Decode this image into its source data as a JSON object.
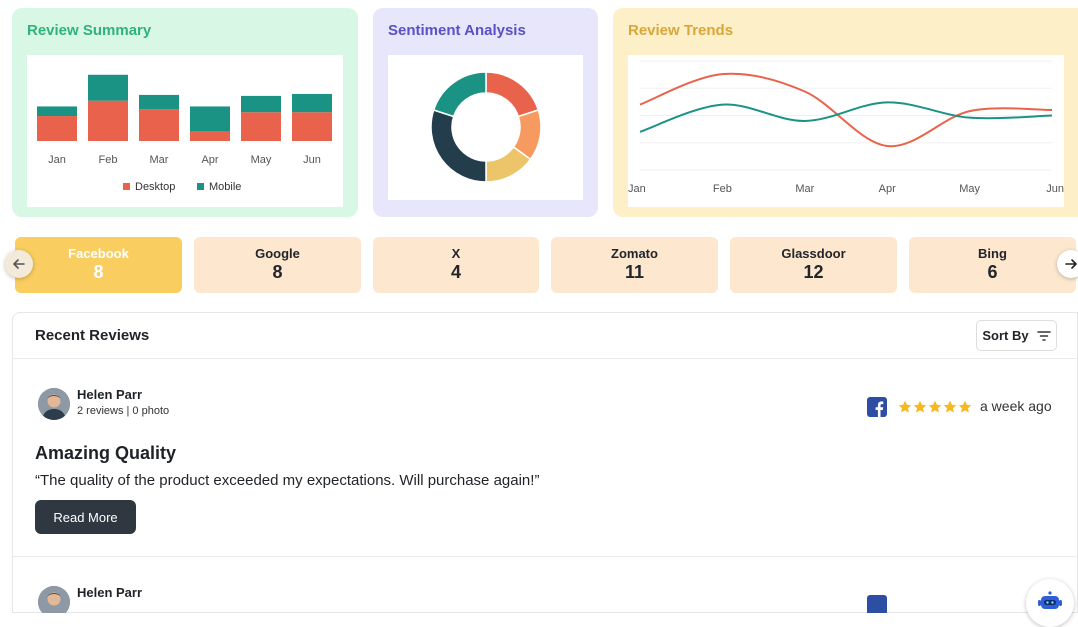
{
  "colors": {
    "desktop": "#e9634c",
    "mobile": "#1a9385",
    "summary_bg": "#d9f7e5",
    "sentiment_bg": "#e8e6fb",
    "trends_bg": "#fdf0c8",
    "chip_bg": "#fde7cf",
    "chip_active_bg": "#f9cd60",
    "button_dark": "#2f3841",
    "star": "#f5b921"
  },
  "review_summary": {
    "title": "Review Summary",
    "chart_data": {
      "type": "bar",
      "stacked": true,
      "categories": [
        "Jan",
        "Feb",
        "Mar",
        "Apr",
        "May",
        "Jun"
      ],
      "series": [
        {
          "name": "Desktop",
          "color": "#e9634c",
          "values": [
            26,
            42,
            33,
            10,
            30,
            30
          ]
        },
        {
          "name": "Mobile",
          "color": "#1a9385",
          "values": [
            10,
            27,
            15,
            26,
            17,
            19
          ]
        }
      ],
      "ylim": [
        0,
        75
      ],
      "legend": "bottom",
      "grid": false
    }
  },
  "sentiment": {
    "title": "Sentiment Analysis",
    "chart_data": {
      "type": "pie",
      "donut": true,
      "slices": [
        {
          "value": 20,
          "color": "#e9634c"
        },
        {
          "value": 15,
          "color": "#f79a5f"
        },
        {
          "value": 15,
          "color": "#ecc56a"
        },
        {
          "value": 30,
          "color": "#233d4d"
        },
        {
          "value": 20,
          "color": "#1a9385"
        }
      ]
    }
  },
  "trends": {
    "title": "Review Trends",
    "chart_data": {
      "type": "line",
      "categories": [
        "Jan",
        "Feb",
        "Mar",
        "Apr",
        "May",
        "Jun"
      ],
      "series": [
        {
          "color": "#e9634c",
          "values": [
            60,
            88,
            72,
            22,
            54,
            55
          ]
        },
        {
          "color": "#1a9385",
          "values": [
            35,
            60,
            45,
            62,
            48,
            50
          ]
        }
      ],
      "ylim": [
        0,
        100
      ],
      "grid": true
    }
  },
  "platforms": [
    {
      "name": "Facebook",
      "count": "8"
    },
    {
      "name": "Google",
      "count": "8"
    },
    {
      "name": "X",
      "count": "4"
    },
    {
      "name": "Zomato",
      "count": "11"
    },
    {
      "name": "Glassdoor",
      "count": "12"
    },
    {
      "name": "Bing",
      "count": "6"
    }
  ],
  "recent": {
    "title": "Recent Reviews",
    "sort_label": "Sort By",
    "reviews": [
      {
        "author": "Helen Parr",
        "meta": "2 reviews | 0 photo",
        "time": "a week ago",
        "rating": 5,
        "headline": "Amazing Quality",
        "body": "“The quality of the product exceeded my expectations. Will purchase again!”",
        "cta": "Read More"
      },
      {
        "author": "Helen Parr"
      }
    ]
  }
}
